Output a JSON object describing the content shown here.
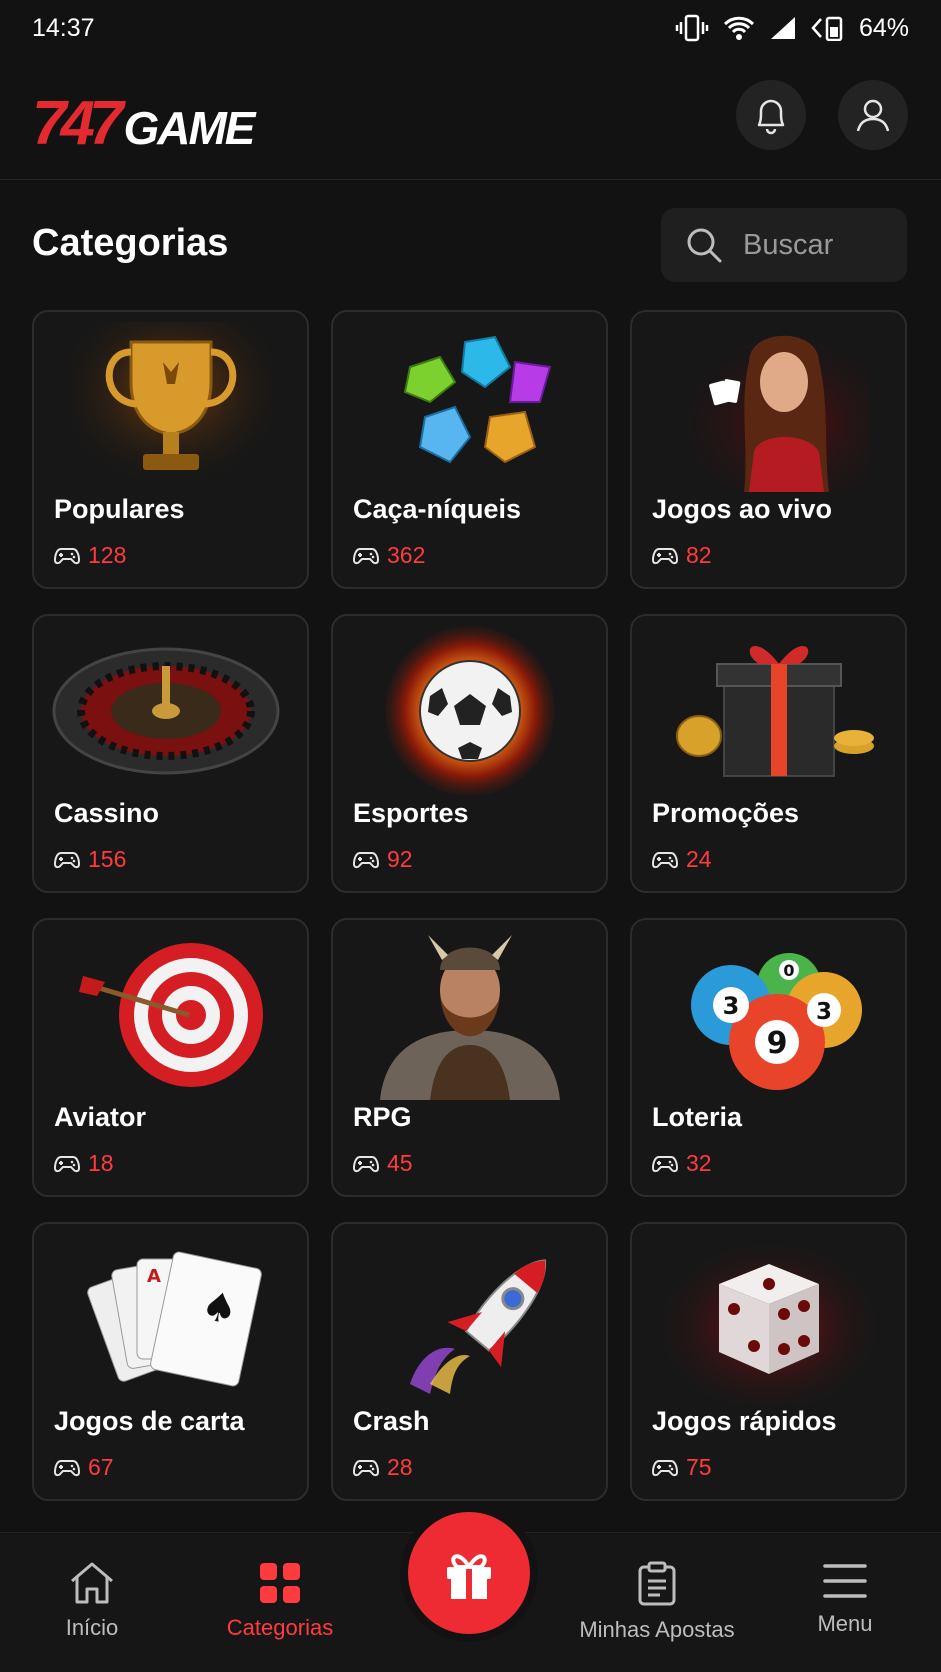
{
  "status_bar": {
    "time": "14:37",
    "battery": "64%"
  },
  "header": {
    "logo_number": "747",
    "logo_text": "GAME"
  },
  "page": {
    "title": "Categorias",
    "search_placeholder": "Buscar"
  },
  "categories": [
    {
      "name": "Populares",
      "count": "128",
      "icon": "trophy-icon"
    },
    {
      "name": "Caça-níqueis",
      "count": "362",
      "icon": "gems-icon"
    },
    {
      "name": "Jogos ao vivo",
      "count": "82",
      "icon": "live-dealer-icon"
    },
    {
      "name": "Cassino",
      "count": "156",
      "icon": "roulette-icon"
    },
    {
      "name": "Esportes",
      "count": "92",
      "icon": "soccer-ball-icon"
    },
    {
      "name": "Promoções",
      "count": "24",
      "icon": "gift-box-icon"
    },
    {
      "name": "Aviator",
      "count": "18",
      "icon": "target-icon"
    },
    {
      "name": "RPG",
      "count": "45",
      "icon": "viking-icon"
    },
    {
      "name": "Loteria",
      "count": "32",
      "icon": "lottery-balls-icon"
    },
    {
      "name": "Jogos de carta",
      "count": "67",
      "icon": "playing-cards-icon"
    },
    {
      "name": "Crash",
      "count": "28",
      "icon": "rocket-icon"
    },
    {
      "name": "Jogos rápidos",
      "count": "75",
      "icon": "dice-icon"
    }
  ],
  "bottom_nav": {
    "home": "Início",
    "categories": "Categorias",
    "bets": "Minhas Apostas",
    "menu": "Menu"
  },
  "colors": {
    "accent": "#ee2b32",
    "background": "#121212",
    "card": "#171717"
  }
}
